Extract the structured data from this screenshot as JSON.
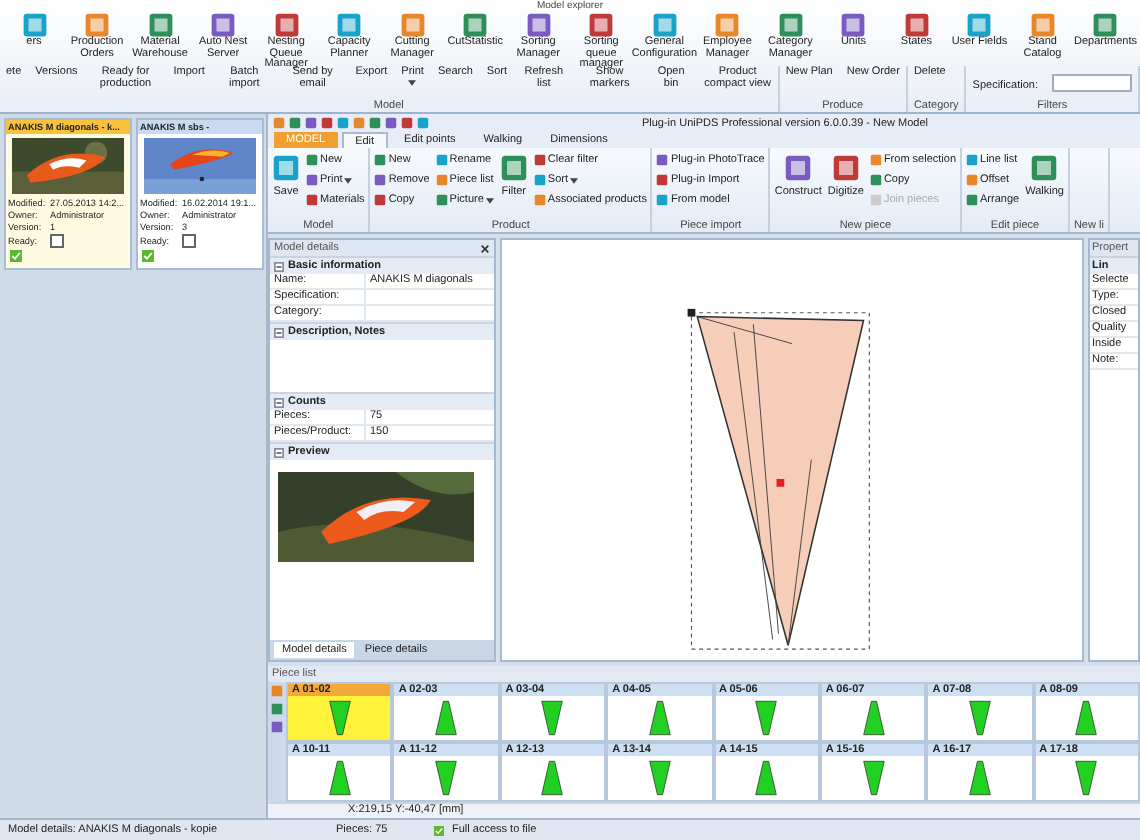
{
  "explorer": {
    "title": "Model explorer",
    "tools": [
      "ers",
      "Production Orders",
      "Material Warehouse",
      "Auto Nest Server",
      "Nesting Queue Manager",
      "Capacity Planner",
      "Cutting Manager",
      "CutStatistic",
      "Sorting Manager",
      "Sorting queue manager",
      "General Configuration",
      "Employee Manager",
      "Category Manager",
      "Units",
      "States",
      "User Fields",
      "Stand Catalog",
      "Departments"
    ],
    "groups": [
      {
        "label": "Model",
        "actions": [
          {
            "label": "ete"
          },
          {
            "label": "Versions"
          },
          {
            "label": "Ready for production"
          },
          {
            "label": "Import"
          },
          {
            "label": "Batch import"
          },
          {
            "label": "Send by email"
          },
          {
            "label": "Export"
          },
          {
            "label": "Print",
            "caret": true
          },
          {
            "label": "Search"
          },
          {
            "label": "Sort"
          },
          {
            "label": "Refresh list"
          },
          {
            "label": "Show markers"
          },
          {
            "label": "Open bin"
          },
          {
            "label": "Product compact view"
          }
        ]
      },
      {
        "label": "Produce",
        "actions": [
          {
            "label": "New Plan"
          },
          {
            "label": "New Order"
          }
        ]
      },
      {
        "label": "Category",
        "actions": [
          {
            "label": "Delete"
          }
        ]
      },
      {
        "label": "Filters",
        "field": "Specification:"
      }
    ]
  },
  "models": [
    {
      "title": "ANAKIS M diagonals - k...",
      "selected": true,
      "fields": [
        {
          "label": "Modified:",
          "value": "27.05.2013 14:2..."
        },
        {
          "label": "Owner:",
          "value": "Administrator"
        },
        {
          "label": "Version:",
          "value": "1"
        }
      ],
      "ready": {
        "label": "Ready:",
        "checked": false
      }
    },
    {
      "title": "ANAKIS M sbs -",
      "selected": false,
      "fields": [
        {
          "label": "Modified:",
          "value": "16.02.2014 19:1..."
        },
        {
          "label": "Owner:",
          "value": "Administrator"
        },
        {
          "label": "Version:",
          "value": "3"
        }
      ],
      "ready": {
        "label": "Ready:",
        "checked": false
      }
    }
  ],
  "editor": {
    "title": "Plug-in UniPDS Professional version 6.0.0.39 - New Model",
    "tabs": [
      {
        "label": "MODEL",
        "kind": "app",
        "selected": false
      },
      {
        "label": "Edit",
        "kind": "tab",
        "selected": true
      },
      {
        "label": "Edit points",
        "kind": "tab",
        "selected": false
      },
      {
        "label": "Walking",
        "kind": "tab",
        "selected": false
      },
      {
        "label": "Dimensions",
        "kind": "tab",
        "selected": false
      }
    ],
    "groups": [
      {
        "label": "Model",
        "items": [
          {
            "label": "Save",
            "kind": "large",
            "disabled": false
          },
          {
            "label": "New",
            "kind": "small",
            "disabled": false
          },
          {
            "label": "Print",
            "kind": "small",
            "caret": true,
            "disabled": false
          },
          {
            "label": "Materials",
            "kind": "small",
            "disabled": false
          }
        ]
      },
      {
        "label": "Product",
        "items": [
          {
            "label": "New",
            "kind": "small",
            "disabled": false
          },
          {
            "label": "Remove",
            "kind": "small",
            "disabled": false
          },
          {
            "label": "Copy",
            "kind": "small",
            "disabled": false
          },
          {
            "label": "Rename",
            "kind": "small",
            "disabled": false
          },
          {
            "label": "Piece list",
            "kind": "small",
            "disabled": false
          },
          {
            "label": "Picture",
            "kind": "small",
            "caret": true,
            "disabled": false
          },
          {
            "label": "Filter",
            "kind": "large",
            "disabled": false
          },
          {
            "label": "Clear filter",
            "kind": "small",
            "disabled": false
          },
          {
            "label": "Sort",
            "kind": "small",
            "caret": true,
            "disabled": false
          },
          {
            "label": "Associated products",
            "kind": "small",
            "disabled": false
          }
        ]
      },
      {
        "label": "Piece import",
        "items": [
          {
            "label": "Plug-in PhotoTrace",
            "kind": "small",
            "disabled": false
          },
          {
            "label": "Plug-in Import",
            "kind": "small",
            "disabled": false
          },
          {
            "label": "From model",
            "kind": "small",
            "disabled": false
          }
        ]
      },
      {
        "label": "New piece",
        "items": [
          {
            "label": "Construct",
            "kind": "large",
            "disabled": false
          },
          {
            "label": "Digitize",
            "kind": "large",
            "disabled": false
          },
          {
            "label": "From selection",
            "kind": "small",
            "disabled": false
          },
          {
            "label": "Copy",
            "kind": "small",
            "disabled": false
          },
          {
            "label": "Join pieces",
            "kind": "small",
            "disabled": true
          }
        ]
      },
      {
        "label": "Edit piece",
        "items": [
          {
            "label": "Line list",
            "kind": "small",
            "disabled": false
          },
          {
            "label": "Offset",
            "kind": "small",
            "disabled": false
          },
          {
            "label": "Arrange",
            "kind": "small",
            "disabled": false
          },
          {
            "label": "Walking",
            "kind": "large",
            "disabled": false
          }
        ]
      },
      {
        "label": "New li"
      }
    ]
  },
  "details": {
    "title": "Model details",
    "sections": [
      {
        "title": "Basic information",
        "expanded": true,
        "kind": "rows",
        "rows": [
          {
            "label": "Name:",
            "value": "ANAKIS M diagonals"
          },
          {
            "label": "Specification:"
          },
          {
            "label": "Category:"
          }
        ]
      },
      {
        "title": "Description, Notes",
        "expanded": true,
        "kind": "notes"
      },
      {
        "title": "Counts",
        "expanded": true,
        "kind": "rows",
        "rows": [
          {
            "label": "Pieces:",
            "value": "75"
          },
          {
            "label": "Pieces/Product:",
            "value": "150"
          }
        ]
      },
      {
        "title": "Preview",
        "expanded": true,
        "kind": "picture"
      }
    ],
    "tabs": [
      {
        "label": "Model details",
        "selected": true
      },
      {
        "label": "Piece details",
        "selected": false
      }
    ]
  },
  "properties": {
    "title": "Propert",
    "section": "Lin",
    "rows": [
      "Selecte",
      "Type:",
      "Closed",
      "Quality",
      "Inside",
      "Note:"
    ]
  },
  "piece_list": {
    "title": "Piece list",
    "pieces": [
      {
        "name": "A 01-02",
        "selected": true,
        "kind": "down"
      },
      {
        "name": "A 02-03",
        "selected": false,
        "kind": "up"
      },
      {
        "name": "A 03-04",
        "selected": false,
        "kind": "down"
      },
      {
        "name": "A 04-05",
        "selected": false,
        "kind": "up"
      },
      {
        "name": "A 05-06",
        "selected": false,
        "kind": "down"
      },
      {
        "name": "A 06-07",
        "selected": false,
        "kind": "up"
      },
      {
        "name": "A 07-08",
        "selected": false,
        "kind": "down"
      },
      {
        "name": "A 08-09",
        "selected": false,
        "kind": "up"
      },
      {
        "name": "A 10-11",
        "selected": false,
        "kind": "up"
      },
      {
        "name": "A 11-12",
        "selected": false,
        "kind": "down"
      },
      {
        "name": "A 12-13",
        "selected": false,
        "kind": "up"
      },
      {
        "name": "A 13-14",
        "selected": false,
        "kind": "down"
      },
      {
        "name": "A 14-15",
        "selected": false,
        "kind": "up"
      },
      {
        "name": "A 15-16",
        "selected": false,
        "kind": "down"
      },
      {
        "name": "A 16-17",
        "selected": false,
        "kind": "up"
      },
      {
        "name": "A 17-18",
        "selected": false,
        "kind": "down"
      }
    ],
    "coordinates": "X:219,15 Y:-40,47 [mm]"
  },
  "status_bar": {
    "model": "Model details: ANAKIS M diagonals - kopie",
    "pieces": "Pieces: 75",
    "access": "Full access to file"
  }
}
